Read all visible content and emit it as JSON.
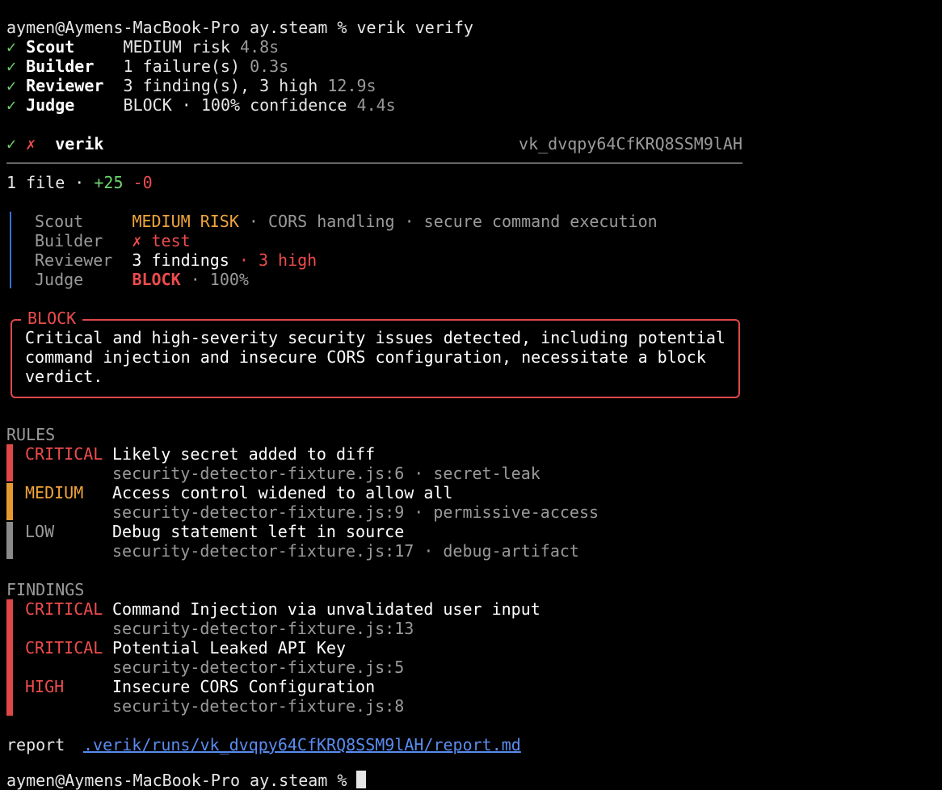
{
  "prompt": "aymen@Aymens-MacBook-Pro ay.steam % ",
  "command": "verik verify",
  "stages": [
    {
      "check": "✓",
      "name": "Scout",
      "pad": "     ",
      "result": "MEDIUM risk",
      "time": "4.8s"
    },
    {
      "check": "✓",
      "name": "Builder",
      "pad": "   ",
      "result": "1 failure(s)",
      "time": "0.3s"
    },
    {
      "check": "✓",
      "name": "Reviewer",
      "pad": "  ",
      "result": "3 finding(s), 3 high",
      "time": "12.9s"
    },
    {
      "check": "✓",
      "name": "Judge",
      "pad": "     ",
      "result": "BLOCK · 100% confidence",
      "time": "4.4s"
    }
  ],
  "header": {
    "check": "✓",
    "cross": "✗",
    "title": "verik",
    "run_id": "vk_dvqpy64CfKRQ8SSM9lAH"
  },
  "diff": {
    "files": "1 file · ",
    "added": "+25",
    "removed": "-0"
  },
  "summary": {
    "scout_label": "Scout",
    "scout_risk": "MEDIUM RISK",
    "scout_tags": " · CORS handling · secure command execution",
    "builder_label": "Builder",
    "builder_result": "✗ test",
    "reviewer_label": "Reviewer",
    "reviewer_count": "3 findings",
    "reviewer_high": " · 3 high",
    "judge_label": "Judge",
    "judge_verdict": "BLOCK",
    "judge_conf": " · 100%"
  },
  "verdict": {
    "title": "BLOCK",
    "line1": "Critical and high-severity security issues detected, including potential",
    "line2": "command injection and insecure CORS configuration, necessitate a block",
    "line3": "verdict."
  },
  "rules": {
    "heading": "RULES",
    "items": [
      {
        "severity": "CRITICAL",
        "color": "#e04848",
        "text": "Likely secret added to diff",
        "location": "security-detector-fixture.js:6 · secret-leak"
      },
      {
        "severity": "MEDIUM",
        "color": "#e49a2e",
        "text": "Access control widened to allow all",
        "location": "security-detector-fixture.js:9 · permissive-access"
      },
      {
        "severity": "LOW",
        "color": "#8a8a8a",
        "text": "Debug statement left in source",
        "location": "security-detector-fixture.js:17 · debug-artifact"
      }
    ]
  },
  "findings": {
    "heading": "FINDINGS",
    "items": [
      {
        "severity": "CRITICAL",
        "text": "Command Injection via unvalidated user input",
        "location": "security-detector-fixture.js:13"
      },
      {
        "severity": "CRITICAL",
        "text": "Potential Leaked API Key",
        "location": "security-detector-fixture.js:5"
      },
      {
        "severity": "HIGH",
        "text": "Insecure CORS Configuration",
        "location": "security-detector-fixture.js:8"
      }
    ]
  },
  "report": {
    "label": "report",
    "path": ".verik/runs/vk_dvqpy64CfKRQ8SSM9lAH/report.md"
  },
  "next_prompt": "aymen@Aymens-MacBook-Pro ay.steam % "
}
